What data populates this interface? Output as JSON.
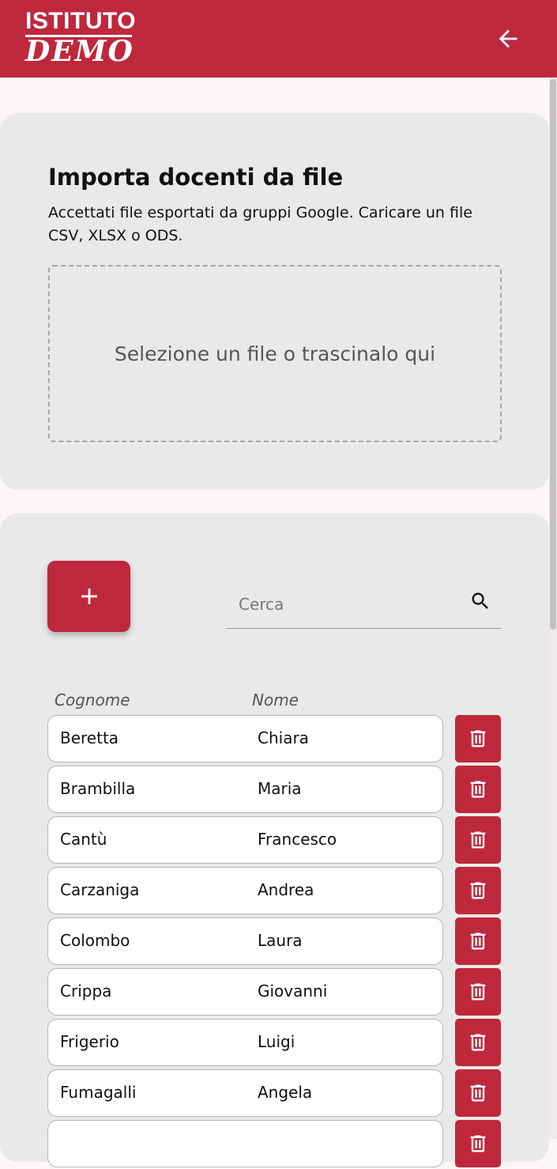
{
  "header": {
    "logo_top": "ISTITUTO",
    "logo_script": "DEMO",
    "back_icon": "arrow-left-icon",
    "bg_color": "#be283c"
  },
  "import": {
    "title": "Importa docenti da file",
    "description": "Accettati file esportati da gruppi Google. Caricare un file CSV, XLSX o ODS.",
    "dropzone_label": "Selezione un file o trascinalo qui"
  },
  "list": {
    "add_icon": "plus-icon",
    "search_placeholder": "Cerca",
    "search_icon": "search-icon",
    "delete_icon": "trash-icon",
    "columns": {
      "surname": "Cognome",
      "name": "Nome"
    },
    "rows": [
      {
        "surname": "Beretta",
        "name": "Chiara"
      },
      {
        "surname": "Brambilla",
        "name": "Maria"
      },
      {
        "surname": "Cantù",
        "name": "Francesco"
      },
      {
        "surname": "Carzaniga",
        "name": "Andrea"
      },
      {
        "surname": "Colombo",
        "name": "Laura"
      },
      {
        "surname": "Crippa",
        "name": "Giovanni"
      },
      {
        "surname": "Frigerio",
        "name": "Luigi"
      },
      {
        "surname": "Fumagalli",
        "name": "Angela"
      }
    ]
  },
  "accent_color": "#be283c"
}
